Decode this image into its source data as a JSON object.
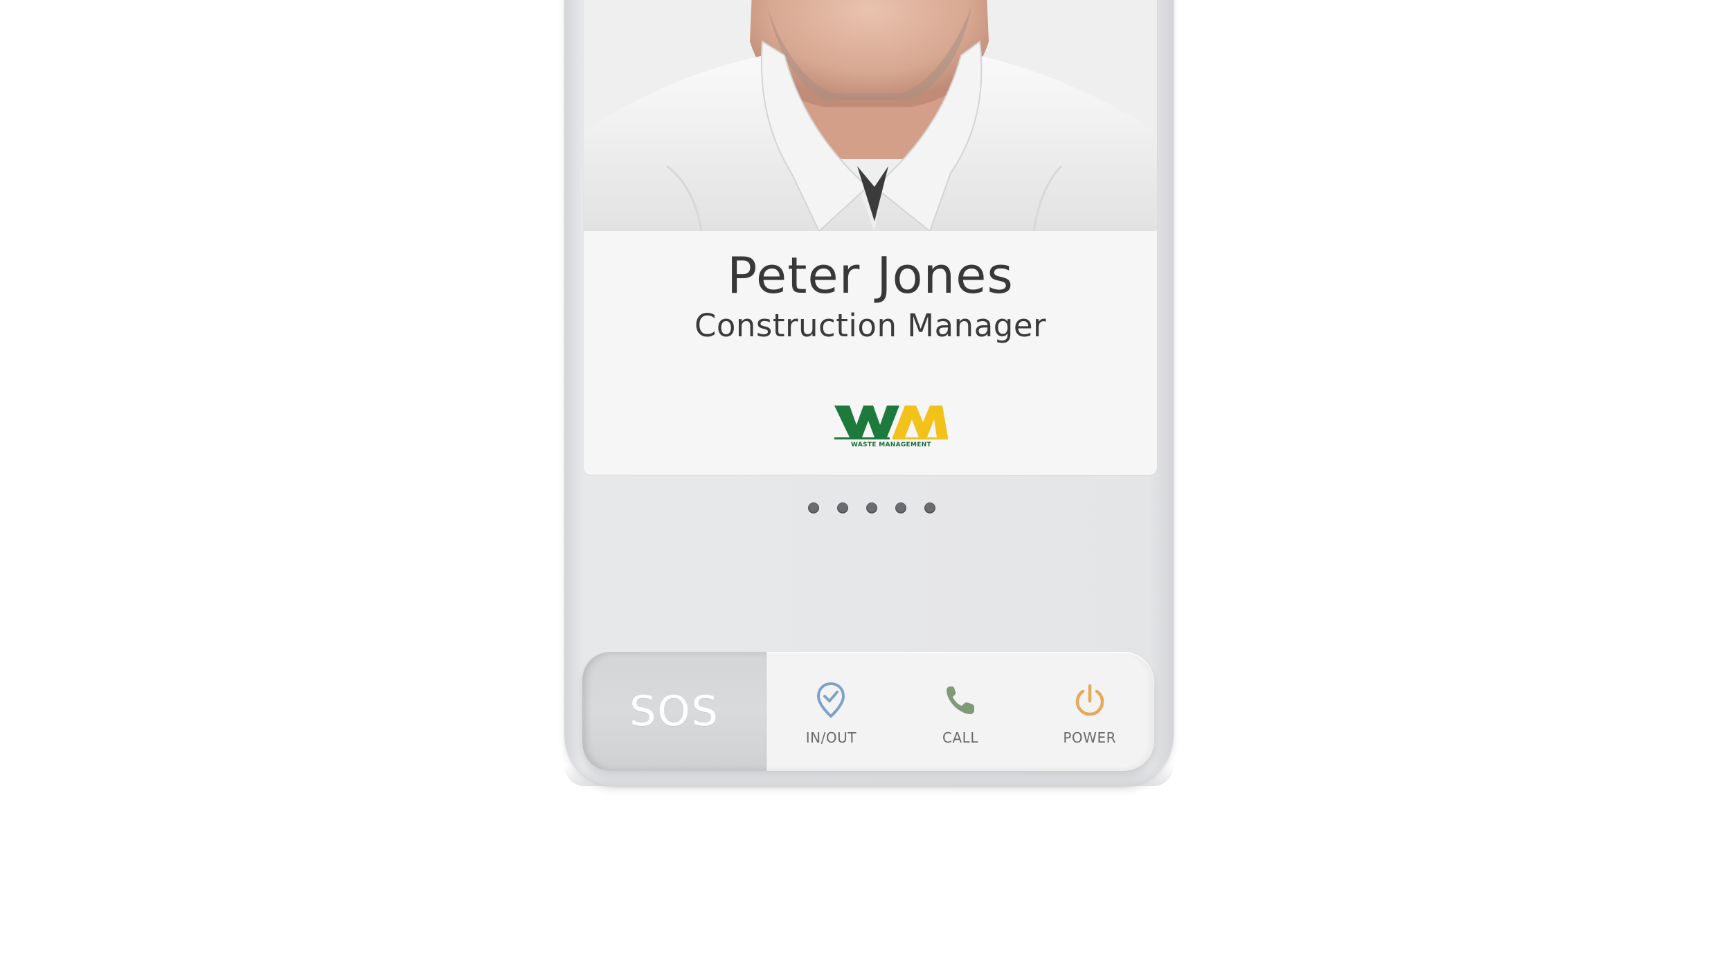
{
  "badge": {
    "name": "Peter Jones",
    "title": "Construction Manager",
    "company_logo": {
      "icon": "wm-logo",
      "caption": "WASTE MANAGEMENT",
      "colors": {
        "green": "#1e7a3c",
        "yellow": "#f2c21b"
      }
    }
  },
  "pager": {
    "count": 5
  },
  "buttons": {
    "sos": {
      "label": "SOS"
    },
    "in_out": {
      "label": "IN/OUT",
      "icon": "location-check-icon",
      "color": "#7da1c9"
    },
    "call": {
      "label": "CALL",
      "icon": "phone-icon",
      "color": "#7f9a78"
    },
    "power": {
      "label": "POWER",
      "icon": "power-icon",
      "color": "#e8a85a"
    }
  }
}
